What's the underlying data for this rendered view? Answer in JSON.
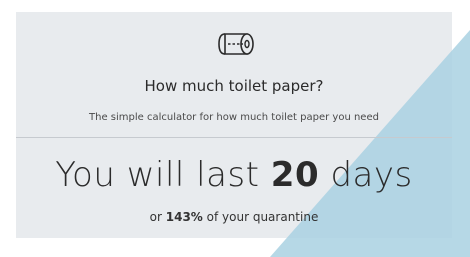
{
  "header": {
    "icon": "toilet-paper-icon",
    "title": "How much toilet paper?",
    "subtitle": "The simple calculator for how much toilet paper you need"
  },
  "result": {
    "prefix": "You will last",
    "days": "20",
    "suffix": "days"
  },
  "detail": {
    "prefix": "or",
    "percent": "143%",
    "suffix": "of your quarantine"
  },
  "colors": {
    "card_background": "#e8ebee",
    "accent_triangle": "#a9d1e2",
    "text": "#2b2b2b"
  }
}
